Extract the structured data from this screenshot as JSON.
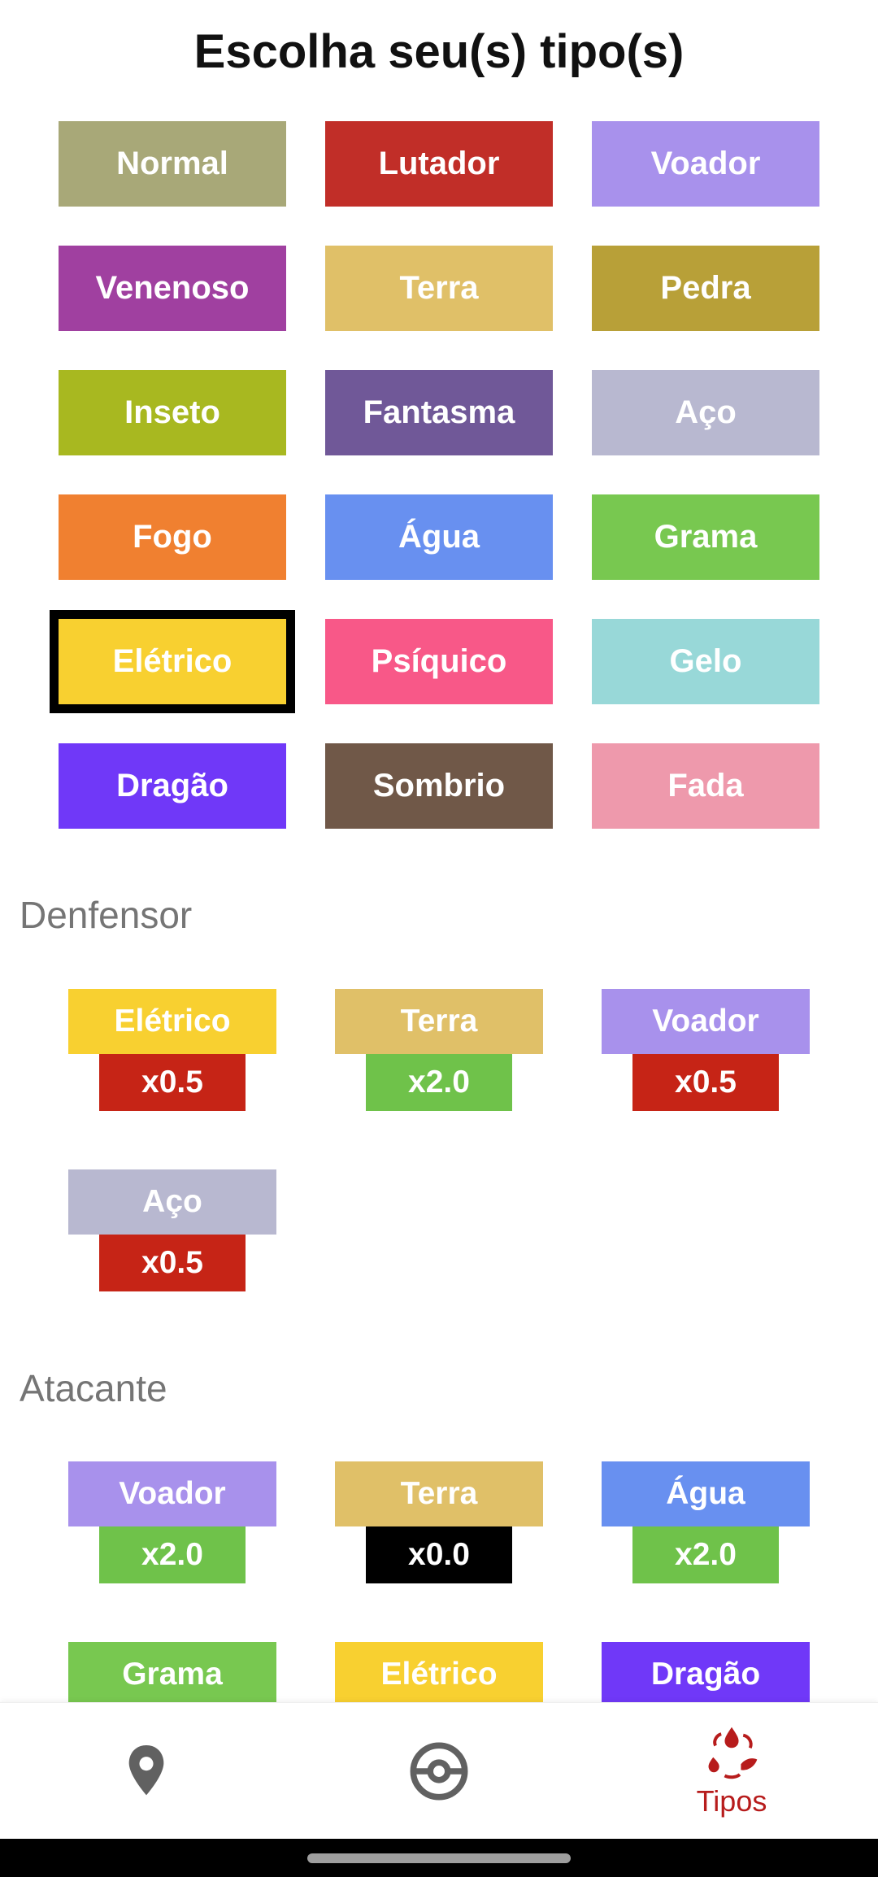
{
  "header": {
    "title": "Escolha seu(s) tipo(s)"
  },
  "types": [
    {
      "label": "Normal",
      "color": "#A8A878"
    },
    {
      "label": "Lutador",
      "color": "#C12E28"
    },
    {
      "label": "Voador",
      "color": "#A891EC"
    },
    {
      "label": "Venenoso",
      "color": "#A040A0"
    },
    {
      "label": "Terra",
      "color": "#E0C068"
    },
    {
      "label": "Pedra",
      "color": "#B8A038"
    },
    {
      "label": "Inseto",
      "color": "#A8B820"
    },
    {
      "label": "Fantasma",
      "color": "#705898"
    },
    {
      "label": "Aço",
      "color": "#B8B8D0"
    },
    {
      "label": "Fogo",
      "color": "#F08030"
    },
    {
      "label": "Água",
      "color": "#6890F0"
    },
    {
      "label": "Grama",
      "color": "#78C850"
    },
    {
      "label": "Elétrico",
      "color": "#F8D030",
      "selected": true
    },
    {
      "label": "Psíquico",
      "color": "#F85888"
    },
    {
      "label": "Gelo",
      "color": "#98D8D8"
    },
    {
      "label": "Dragão",
      "color": "#7038F8"
    },
    {
      "label": "Sombrio",
      "color": "#705848"
    },
    {
      "label": "Fada",
      "color": "#EE99AC"
    }
  ],
  "defensor": {
    "label": "Denfensor",
    "items": [
      {
        "type": "Elétrico",
        "color": "#F8D030",
        "mult": "x0.5",
        "mult_color": "#C62416"
      },
      {
        "type": "Terra",
        "color": "#E0C068",
        "mult": "x2.0",
        "mult_color": "#6FC24A"
      },
      {
        "type": "Voador",
        "color": "#A891EC",
        "mult": "x0.5",
        "mult_color": "#C62416"
      },
      {
        "type": "Aço",
        "color": "#B8B8D0",
        "mult": "x0.5",
        "mult_color": "#C62416"
      }
    ]
  },
  "atacante": {
    "label": "Atacante",
    "items": [
      {
        "type": "Voador",
        "color": "#A891EC",
        "mult": "x2.0",
        "mult_color": "#6FC24A"
      },
      {
        "type": "Terra",
        "color": "#E0C068",
        "mult": "x0.0",
        "mult_color": "#000000"
      },
      {
        "type": "Água",
        "color": "#6890F0",
        "mult": "x2.0",
        "mult_color": "#6FC24A"
      },
      {
        "type": "Grama",
        "color": "#78C850",
        "mult": "",
        "mult_color": "#6FC24A"
      },
      {
        "type": "Elétrico",
        "color": "#F8D030",
        "mult": "",
        "mult_color": "#C62416"
      },
      {
        "type": "Dragão",
        "color": "#7038F8",
        "mult": "",
        "mult_color": "#C62416"
      }
    ]
  },
  "bottom_nav": {
    "items": [
      {
        "icon": "map-pin-icon",
        "label": ""
      },
      {
        "icon": "pokeball-icon",
        "label": ""
      },
      {
        "icon": "types-cycle-icon",
        "label": "Tipos",
        "active": true
      }
    ],
    "accent": "#B71C1C"
  }
}
